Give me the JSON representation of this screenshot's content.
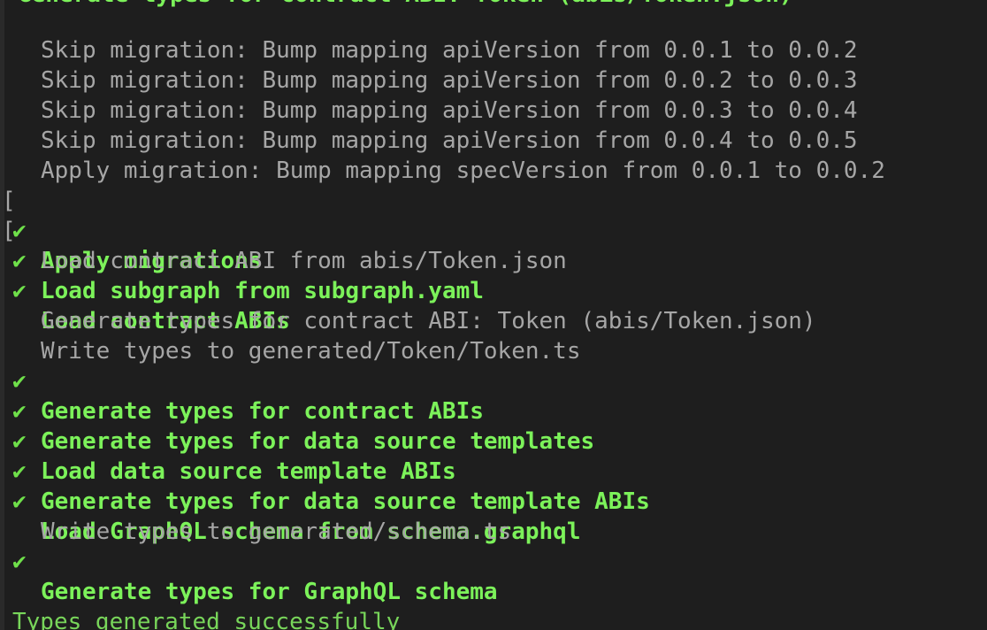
{
  "cutoff_line": "Generate types for contract ABI: Token (abis/Token.json)",
  "lines": [
    {
      "text": "Skip migration: Bump mapping apiVersion from 0.0.1 to 0.0.2",
      "bracket": "",
      "check": ""
    },
    {
      "text": "Skip migration: Bump mapping apiVersion from 0.0.2 to 0.0.3",
      "bracket": "",
      "check": ""
    },
    {
      "text": "Skip migration: Bump mapping apiVersion from 0.0.3 to 0.0.4",
      "bracket": "",
      "check": ""
    },
    {
      "text": "Skip migration: Bump mapping apiVersion from 0.0.4 to 0.0.5",
      "bracket": "",
      "check": ""
    },
    {
      "text": "Apply migration: Bump mapping specVersion from 0.0.1 to 0.0.2",
      "bracket": "",
      "check": ""
    },
    {
      "text": "Apply migrations",
      "bracket": "[",
      "check": "✔"
    },
    {
      "text": "Load subgraph from subgraph.yaml",
      "bracket": "[",
      "check": "✔"
    },
    {
      "text": "Load contract ABI from abis/Token.json",
      "bracket": "",
      "check": ""
    },
    {
      "text": "Load contract ABIs",
      "bracket": "",
      "check": "✔"
    },
    {
      "text": "Generate types for contract ABI: Token (abis/Token.json)",
      "bracket": "",
      "check": ""
    },
    {
      "text": "Write types to generated/Token/Token.ts",
      "bracket": "",
      "check": ""
    },
    {
      "text": "Generate types for contract ABIs",
      "bracket": "",
      "check": "✔"
    },
    {
      "text": "Generate types for data source templates",
      "bracket": "",
      "check": "✔"
    },
    {
      "text": "Load data source template ABIs",
      "bracket": "",
      "check": "✔"
    },
    {
      "text": "Generate types for data source template ABIs",
      "bracket": "",
      "check": "✔"
    },
    {
      "text": "Load GraphQL schema from schema.graphql",
      "bracket": "",
      "check": "✔"
    },
    {
      "text": "Write types to generated/schema.ts",
      "bracket": "",
      "check": ""
    },
    {
      "text": "Generate types for GraphQL schema",
      "bracket": "",
      "check": "✔"
    }
  ],
  "success_message": "Types generated successfully",
  "colors": {
    "background": "#1e1e1e",
    "success_green": "#7cf25a",
    "dim_text": "#a6a6a6"
  }
}
